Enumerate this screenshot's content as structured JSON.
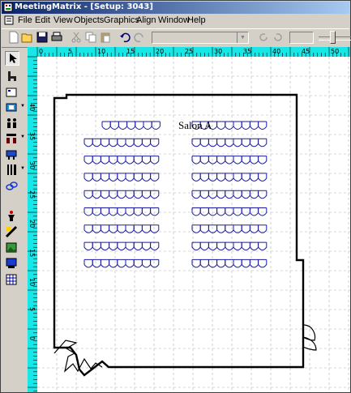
{
  "window": {
    "title": "MeetingMatrix - [Setup: 3043]"
  },
  "menu": {
    "items": [
      "File",
      "Edit",
      "View",
      "Objects",
      "Graphics",
      "Align",
      "Window",
      "Help"
    ]
  },
  "toolbar": {
    "buttons": [
      "new-icon",
      "open-icon",
      "save-icon",
      "print-icon",
      "cut-icon",
      "copy-icon",
      "paste-icon",
      "undo-icon",
      "redo-icon",
      "rotate-cw-icon",
      "rotate-ccw-icon"
    ],
    "combo_value": "",
    "spin_value": ""
  },
  "left_tools": [
    "pointer-icon",
    "podium-icon",
    "room-icon",
    "table-icon",
    "people-icon",
    "chairs-icon",
    "desk-icon",
    "utensils-icon",
    "link-icon",
    "person-icon",
    "stage-icon",
    "image-icon",
    "screen-icon",
    "grid-icon"
  ],
  "ruler": {
    "top_labels": [
      "0",
      "5",
      "10",
      "15",
      "20",
      "25",
      "30",
      "35",
      "40",
      "45",
      "50"
    ],
    "left_labels": [
      "40",
      "35",
      "30",
      "25",
      "20",
      "15",
      "10",
      "5",
      "0"
    ]
  },
  "room": {
    "name": "Salon A",
    "rows": 9,
    "left_block_first_row_chairs": 7,
    "left_block_chairs": 9,
    "right_block_chairs": 9
  },
  "colors": {
    "titlebar_start": "#0a246a",
    "titlebar_end": "#a6caf0",
    "ruler": "#19e6e6",
    "chair": "#1a1aa0",
    "grid": "#b0b0b0"
  }
}
